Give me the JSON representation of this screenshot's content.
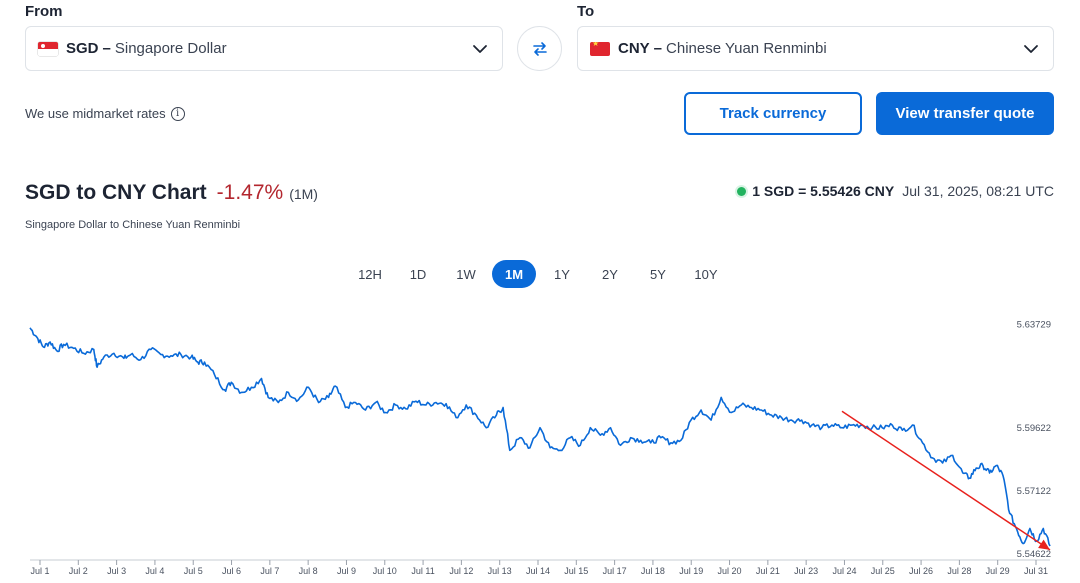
{
  "from": {
    "label": "From",
    "code": "SGD",
    "name": "Singapore Dollar"
  },
  "to": {
    "label": "To",
    "code": "CNY",
    "name": "Chinese Yuan Renminbi"
  },
  "dash": "–",
  "midmarket_note": "We use midmarket rates",
  "info_symbol": "i",
  "buttons": {
    "track": "Track currency",
    "quote": "View transfer quote"
  },
  "chart_header": {
    "title": "SGD to CNY Chart",
    "change": "-1.47%",
    "period": "(1M)",
    "subtitle": "Singapore Dollar to Chinese Yuan Renminbi",
    "rate": "1 SGD = 5.55426 CNY",
    "timestamp": "Jul 31, 2025, 08:21 UTC"
  },
  "ranges": [
    {
      "label": "12H",
      "active": false
    },
    {
      "label": "1D",
      "active": false
    },
    {
      "label": "1W",
      "active": false
    },
    {
      "label": "1M",
      "active": true
    },
    {
      "label": "1Y",
      "active": false
    },
    {
      "label": "2Y",
      "active": false
    },
    {
      "label": "5Y",
      "active": false
    },
    {
      "label": "10Y",
      "active": false
    }
  ],
  "colors": {
    "accent": "#0a6ad8",
    "negative": "#b3262e",
    "live": "#22b35f",
    "annotation": "#e8211d"
  },
  "chart_data": {
    "type": "line",
    "x_ticks": [
      "Jul 1",
      "Jul 2",
      "Jul 3",
      "Jul 4",
      "Jul 5",
      "Jul 6",
      "Jul 7",
      "Jul 8",
      "Jul 9",
      "Jul 10",
      "Jul 11",
      "Jul 12",
      "Jul 13",
      "Jul 14",
      "Jul 15",
      "Jul 17",
      "Jul 18",
      "Jul 19",
      "Jul 20",
      "Jul 21",
      "Jul 23",
      "Jul 24",
      "Jul 25",
      "Jul 26",
      "Jul 28",
      "Jul 29",
      "Jul 31"
    ],
    "y_ticks": [
      5.63729,
      5.59622,
      5.57122,
      5.54622
    ],
    "y_tick_labels": [
      "5.63729",
      "5.59622",
      "5.57122",
      "5.54622"
    ],
    "ylim": [
      5.5435,
      5.6399
    ],
    "x_range": [
      1,
      31.4
    ],
    "series": [
      {
        "points": [
          [
            1.0,
            5.6356
          ],
          [
            1.2,
            5.632
          ],
          [
            1.4,
            5.628
          ],
          [
            1.6,
            5.63
          ],
          [
            1.8,
            5.6265
          ],
          [
            2.0,
            5.629
          ],
          [
            2.3,
            5.6275
          ],
          [
            2.6,
            5.6255
          ],
          [
            2.9,
            5.627
          ],
          [
            3.0,
            5.62
          ],
          [
            3.2,
            5.624
          ],
          [
            3.5,
            5.6255
          ],
          [
            3.8,
            5.6235
          ],
          [
            4.0,
            5.625
          ],
          [
            4.3,
            5.623
          ],
          [
            4.6,
            5.627
          ],
          [
            4.9,
            5.625
          ],
          [
            5.2,
            5.6245
          ],
          [
            5.5,
            5.625
          ],
          [
            5.8,
            5.624
          ],
          [
            6.0,
            5.622
          ],
          [
            6.2,
            5.622
          ],
          [
            6.5,
            5.617
          ],
          [
            6.8,
            5.611
          ],
          [
            7.0,
            5.614
          ],
          [
            7.3,
            5.61
          ],
          [
            7.6,
            5.612
          ],
          [
            7.9,
            5.6155
          ],
          [
            8.1,
            5.608
          ],
          [
            8.4,
            5.606
          ],
          [
            8.7,
            5.61
          ],
          [
            9.0,
            5.607
          ],
          [
            9.3,
            5.612
          ],
          [
            9.6,
            5.606
          ],
          [
            9.9,
            5.608
          ],
          [
            10.1,
            5.6125
          ],
          [
            10.4,
            5.604
          ],
          [
            10.7,
            5.606
          ],
          [
            11.0,
            5.603
          ],
          [
            11.3,
            5.606
          ],
          [
            11.6,
            5.602
          ],
          [
            11.9,
            5.605
          ],
          [
            12.2,
            5.6035
          ],
          [
            12.5,
            5.6065
          ],
          [
            12.8,
            5.605
          ],
          [
            13.1,
            5.606
          ],
          [
            13.4,
            5.6055
          ],
          [
            13.7,
            5.6
          ],
          [
            14.0,
            5.605
          ],
          [
            14.3,
            5.601
          ],
          [
            14.6,
            5.596
          ],
          [
            14.9,
            5.601
          ],
          [
            15.1,
            5.604
          ],
          [
            15.3,
            5.587
          ],
          [
            15.6,
            5.592
          ],
          [
            15.9,
            5.588
          ],
          [
            16.2,
            5.596
          ],
          [
            16.5,
            5.588
          ],
          [
            16.8,
            5.587
          ],
          [
            17.1,
            5.592
          ],
          [
            17.4,
            5.589
          ],
          [
            17.7,
            5.596
          ],
          [
            18.0,
            5.593
          ],
          [
            18.3,
            5.596
          ],
          [
            18.6,
            5.589
          ],
          [
            18.9,
            5.592
          ],
          [
            19.2,
            5.591
          ],
          [
            19.5,
            5.59
          ],
          [
            19.8,
            5.592
          ],
          [
            20.1,
            5.59
          ],
          [
            20.4,
            5.591
          ],
          [
            20.7,
            5.599
          ],
          [
            21.0,
            5.603
          ],
          [
            21.3,
            5.599
          ],
          [
            21.6,
            5.608
          ],
          [
            21.9,
            5.602
          ],
          [
            22.2,
            5.605
          ],
          [
            22.5,
            5.604
          ],
          [
            22.8,
            5.603
          ],
          [
            23.1,
            5.601
          ],
          [
            23.4,
            5.6
          ],
          [
            23.7,
            5.599
          ],
          [
            24.0,
            5.599
          ],
          [
            24.3,
            5.597
          ],
          [
            24.6,
            5.596
          ],
          [
            24.9,
            5.597
          ],
          [
            25.2,
            5.596
          ],
          [
            25.5,
            5.597
          ],
          [
            25.8,
            5.597
          ],
          [
            26.1,
            5.596
          ],
          [
            26.4,
            5.596
          ],
          [
            26.7,
            5.597
          ],
          [
            27.0,
            5.595
          ],
          [
            27.3,
            5.597
          ],
          [
            27.6,
            5.59
          ],
          [
            27.9,
            5.584
          ],
          [
            28.2,
            5.582
          ],
          [
            28.5,
            5.585
          ],
          [
            28.8,
            5.578
          ],
          [
            29.0,
            5.576
          ],
          [
            29.2,
            5.58
          ],
          [
            29.4,
            5.581
          ],
          [
            29.6,
            5.578
          ],
          [
            29.8,
            5.581
          ],
          [
            30.0,
            5.577
          ],
          [
            30.2,
            5.562
          ],
          [
            30.4,
            5.556
          ],
          [
            30.6,
            5.55
          ],
          [
            30.8,
            5.556
          ],
          [
            31.0,
            5.551
          ],
          [
            31.2,
            5.556
          ],
          [
            31.4,
            5.549
          ]
        ]
      }
    ],
    "trend_arrow": {
      "from": [
        25.2,
        5.6025
      ],
      "to": [
        31.4,
        5.5475
      ]
    },
    "grid": false,
    "legend": "none"
  }
}
